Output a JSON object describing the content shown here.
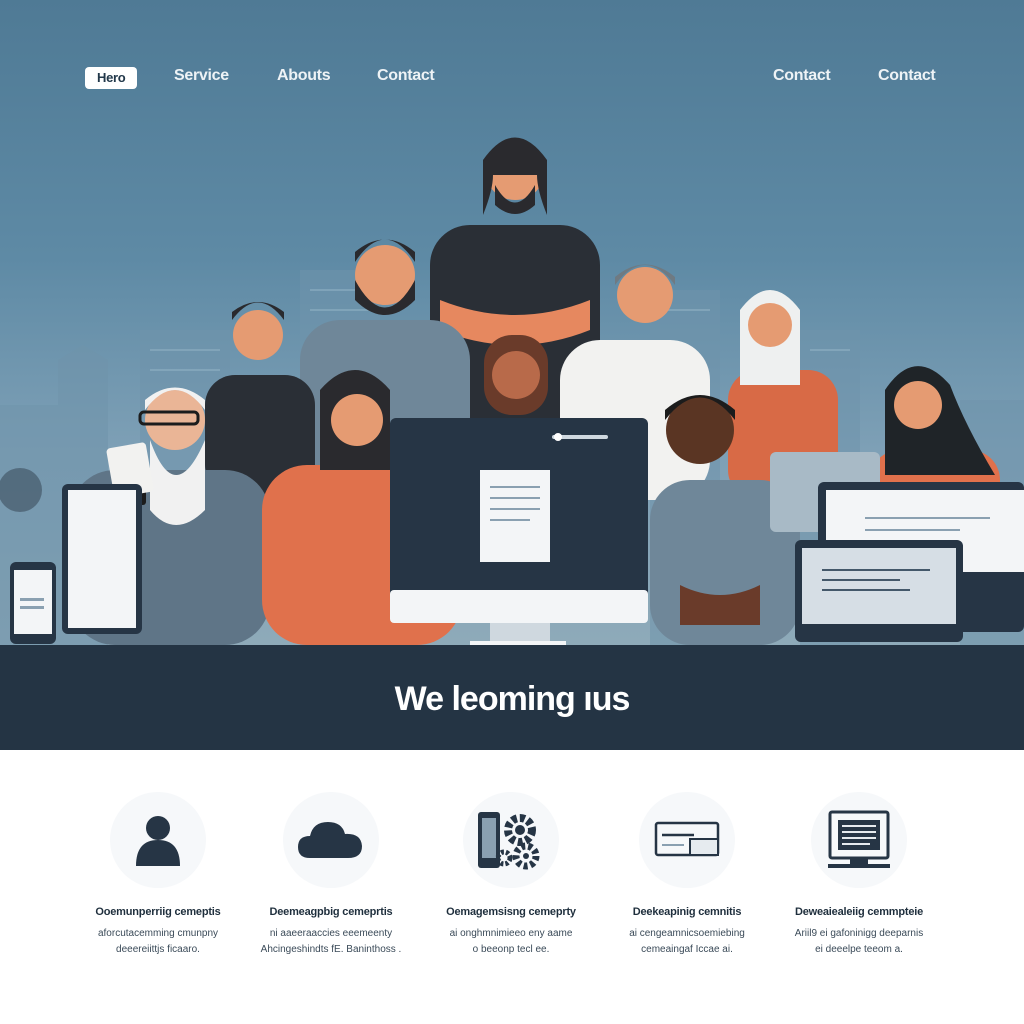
{
  "nav": {
    "items": [
      "Hero",
      "Service",
      "Abouts",
      "Contact",
      "Contact",
      "Contact"
    ]
  },
  "hero": {
    "illustration": "team of people at computers"
  },
  "banner": {
    "title": "We leoming ıus"
  },
  "features": [
    {
      "icon": "user-icon",
      "title": "Ooemunperriig cemeptis",
      "lines": [
        "aforcutacemming cmunpny",
        "deeereiittjs ficaaro."
      ]
    },
    {
      "icon": "cloud-icon",
      "title": "Deemeagpbig cemeprtis",
      "lines": [
        "ni aaeeraaccies eeemeenty",
        "Ahcingeshindts fE. Baninthoss ."
      ]
    },
    {
      "icon": "gear-icon",
      "title": "Oemagemsisng cemeprty",
      "lines": [
        "ai onghmnimieeo eny aame",
        "o beeonp tecl ee."
      ]
    },
    {
      "icon": "window-icon",
      "title": "Deekeapinig cemnitis",
      "lines": [
        "ai cengeamnicsoemiebing",
        "cemeaingaf Iccae ai."
      ]
    },
    {
      "icon": "monitor-icon",
      "title": "Deweaiealeiig cemmpteie",
      "lines": [
        "Ariil9 ei gafoninigg deeparnis",
        "ei deeelpe teeom a."
      ]
    }
  ],
  "colors": {
    "hero_bg": "#5e8aa5",
    "banner_bg": "#243444",
    "accent_orange": "#e0714c"
  }
}
